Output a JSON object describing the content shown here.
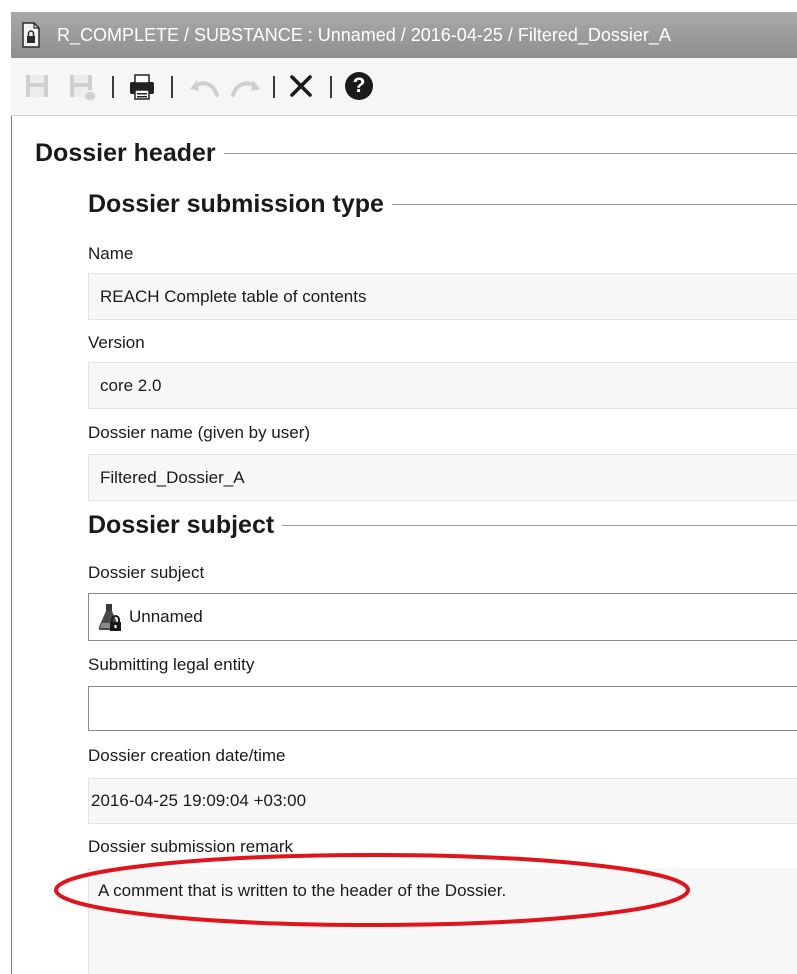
{
  "window": {
    "title": "R_COMPLETE / SUBSTANCE : Unnamed / 2016-04-25 / Filtered_Dossier_A"
  },
  "toolbar": {
    "buttons": [
      "save-icon",
      "save-disabled-icon",
      "print-icon",
      "undo-icon",
      "redo-icon",
      "close-icon",
      "help-icon"
    ],
    "help_glyph": "?"
  },
  "dossier_header": {
    "title": "Dossier header",
    "submission_type": {
      "title": "Dossier submission type",
      "name_label": "Name",
      "name_value": "REACH Complete table of contents",
      "version_label": "Version",
      "version_value": "core 2.0",
      "dossier_name_label": "Dossier name (given by user)",
      "dossier_name_value": "Filtered_Dossier_A"
    },
    "subject": {
      "title": "Dossier subject",
      "subject_label": "Dossier subject",
      "subject_value": "Unnamed",
      "legal_entity_label": "Submitting legal entity",
      "legal_entity_value": "",
      "creation_label": "Dossier creation date/time",
      "creation_value": "2016-04-25 19:09:04 +03:00",
      "remark_label": "Dossier submission remark",
      "remark_value": "A comment that is written to the header of the Dossier."
    }
  },
  "colors": {
    "titlebar": "#9c9c9c",
    "highlight_ellipse": "#e0141a",
    "field_background": "#f7f7f7"
  }
}
